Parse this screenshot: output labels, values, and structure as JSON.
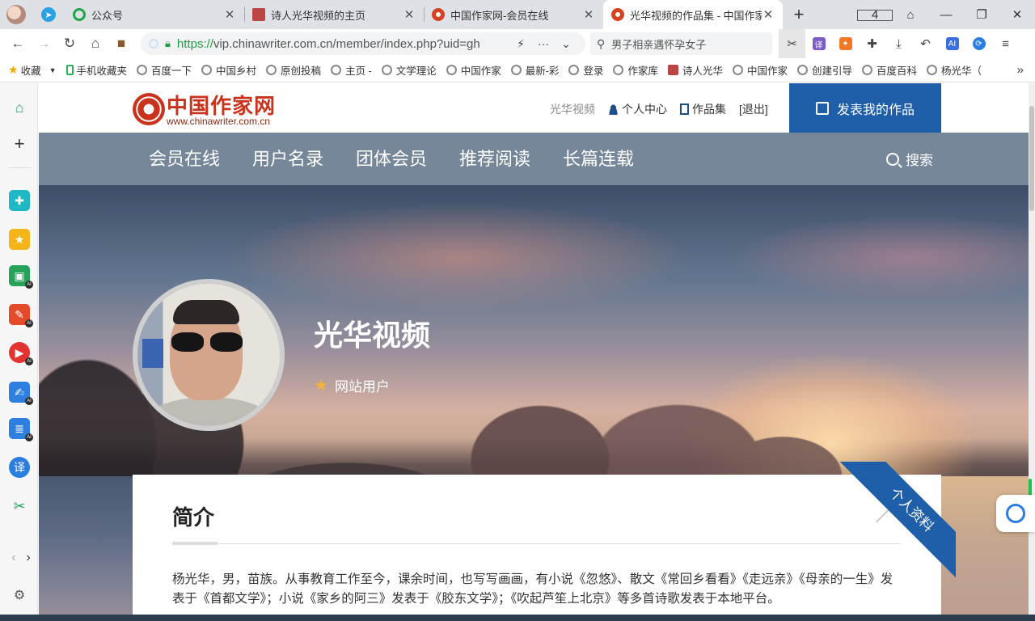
{
  "browser": {
    "tabs": [
      {
        "title": "公众号",
        "icon": "wechat-green"
      },
      {
        "title": "诗人光华视频的主页",
        "icon": "poet-red"
      },
      {
        "title": "中国作家网-会员在线",
        "icon": "chinawriter"
      },
      {
        "title": "光华视频的作品集 - 中国作家",
        "icon": "chinawriter",
        "active": true
      }
    ],
    "tab_count": "4",
    "url_scheme": "https://",
    "url_rest": "vip.chinawriter.com.cn/member/index.php?uid=gh",
    "search_text": "男子相亲遇怀孕女子",
    "bookmarks": [
      {
        "label": "收藏",
        "icon": "star-icon"
      },
      {
        "label": "手机收藏夹",
        "icon": "phone-icon"
      },
      {
        "label": "百度一下",
        "icon": "globe-icon"
      },
      {
        "label": "中国乡村",
        "icon": "globe-icon"
      },
      {
        "label": "原创投稿",
        "icon": "globe-icon"
      },
      {
        "label": "主页 -",
        "icon": "globe-icon"
      },
      {
        "label": "文学理论",
        "icon": "globe-icon"
      },
      {
        "label": "中国作家",
        "icon": "globe-icon"
      },
      {
        "label": "最新-彩",
        "icon": "globe-icon"
      },
      {
        "label": "登录",
        "icon": "globe-icon"
      },
      {
        "label": "作家库",
        "icon": "globe-icon"
      },
      {
        "label": "诗人光华",
        "icon": "poet-icon"
      },
      {
        "label": "中国作家",
        "icon": "globe-icon"
      },
      {
        "label": "创建引导",
        "icon": "globe-icon"
      },
      {
        "label": "百度百科",
        "icon": "globe-icon"
      },
      {
        "label": "杨光华（",
        "icon": "globe-icon"
      }
    ]
  },
  "site": {
    "logo_cn": "中国作家网",
    "logo_en": "www.chinawriter.com.cn",
    "header": {
      "username": "光华视频",
      "personal_center": "个人中心",
      "collection": "作品集",
      "logout": "[退出]",
      "publish": "发表我的作品"
    },
    "nav": [
      "会员在线",
      "用户名录",
      "团体会员",
      "推荐阅读",
      "长篇连载"
    ],
    "search": "搜索",
    "profile": {
      "name": "光华视频",
      "role": "网站用户"
    },
    "intro": {
      "title": "简介",
      "ribbon": "个人资料",
      "text": "杨光华，男，苗族。从事教育工作至今，课余时间，也写写画画，有小说《忽悠》、散文《常回乡看看》《走远亲》《母亲的一生》发表于《首都文学》；小说《家乡的阿三》发表于《胶东文学》；《吹起芦笙上北京》等多首诗歌发表于本地平台。"
    }
  },
  "colors": {
    "brand_red": "#c9321c",
    "brand_blue": "#1f5ea8",
    "nav_bg": "#76879a"
  }
}
